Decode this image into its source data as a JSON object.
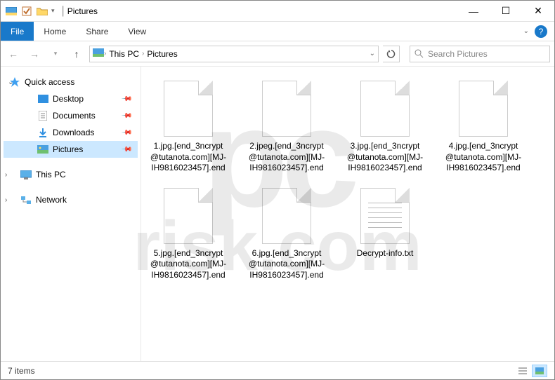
{
  "window": {
    "title": "Pictures",
    "controls": {
      "min": "—",
      "max": "☐",
      "close": "✕"
    }
  },
  "ribbon": {
    "file": "File",
    "tabs": [
      "Home",
      "Share",
      "View"
    ]
  },
  "nav": {
    "crumbs": [
      "This PC",
      "Pictures"
    ],
    "search_placeholder": "Search Pictures"
  },
  "sidebar": {
    "quick_access": "Quick access",
    "items": [
      {
        "label": "Desktop",
        "icon": "desktop"
      },
      {
        "label": "Documents",
        "icon": "doc"
      },
      {
        "label": "Downloads",
        "icon": "down"
      },
      {
        "label": "Pictures",
        "icon": "pic",
        "selected": true
      }
    ],
    "this_pc": "This PC",
    "network": "Network"
  },
  "files": [
    {
      "name": "1.jpg.[end_3ncrypt@tutanota.com][MJ-IH9816023457].end",
      "type": "blank"
    },
    {
      "name": "2.jpeg.[end_3ncrypt@tutanota.com][MJ-IH9816023457].end",
      "type": "blank"
    },
    {
      "name": "3.jpg.[end_3ncrypt@tutanota.com][MJ-IH9816023457].end",
      "type": "blank"
    },
    {
      "name": "4.jpg.[end_3ncrypt@tutanota.com][MJ-IH9816023457].end",
      "type": "blank"
    },
    {
      "name": "5.jpg.[end_3ncrypt@tutanota.com][MJ-IH9816023457].end",
      "type": "blank"
    },
    {
      "name": "6.jpg.[end_3ncrypt@tutanota.com][MJ-IH9816023457].end",
      "type": "blank"
    },
    {
      "name": "Decrypt-info.txt",
      "type": "txt"
    }
  ],
  "status": {
    "count": "7 items"
  },
  "watermark": {
    "top": "pc",
    "bottom": "risk.com"
  }
}
